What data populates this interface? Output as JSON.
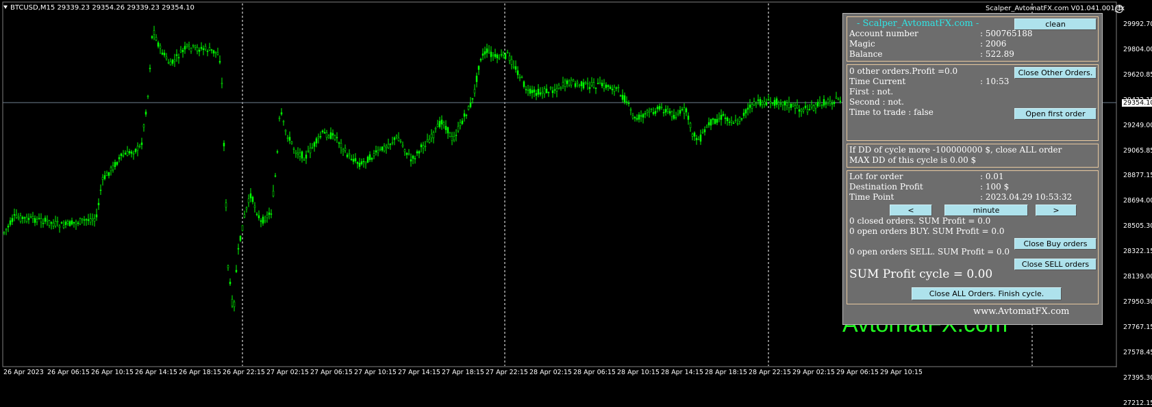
{
  "header": {
    "symbol_info": "BTCUSD,M15  29339.23 29354.26 29339.23 29354.10",
    "ea_name": "Scalper_AvtomatFX.com V01.041.001_fx",
    "smiley": "☺"
  },
  "watermark": "AvtomatFX.com",
  "price_axis": {
    "labels": [
      "29992.70",
      "29804.00",
      "29620.85",
      "29432.15",
      "29249.00",
      "29065.85",
      "28877.15",
      "28694.00",
      "28505.30",
      "28322.15",
      "28139.00",
      "27950.30",
      "27767.15",
      "27578.45",
      "27395.30",
      "27212.15"
    ],
    "current_price": "29354.10"
  },
  "time_axis": {
    "labels": [
      "26 Apr 2023",
      "26 Apr 06:15",
      "26 Apr 10:15",
      "26 Apr 14:15",
      "26 Apr 18:15",
      "26 Apr 22:15",
      "27 Apr 02:15",
      "27 Apr 06:15",
      "27 Apr 10:15",
      "27 Apr 14:15",
      "27 Apr 18:15",
      "27 Apr 22:15",
      "28 Apr 02:15",
      "28 Apr 06:15",
      "28 Apr 10:15",
      "28 Apr 14:15",
      "28 Apr 18:15",
      "28 Apr 22:15",
      "29 Apr 02:15",
      "29 Apr 06:15",
      "29 Apr 10:15"
    ]
  },
  "colors": {
    "candle": "#00ff00",
    "grid": "#ffffff",
    "bid_line": "#708090",
    "panel_bg": "#6d6d6d",
    "title": "#2ee6e6",
    "button_bg": "#aee2ec"
  },
  "panel": {
    "header": {
      "title": "- Scalper_AvtomatFX.com -",
      "clean_label": "clean",
      "account_label": "Account number",
      "account_value": ": 500765188",
      "magic_label": "Magic",
      "magic_value": ": 2006",
      "balance_label": "Balance",
      "balance_value": ": 522.89"
    },
    "status": {
      "other_orders": "0 other orders.Profit =0.0",
      "close_other_label": "Close Other Orders.",
      "time_current_label": "Time Current",
      "time_current_value": ": 10:53",
      "first": "First      : not.",
      "second": "Second  : not.",
      "time_to_trade": "Time to trade :  false",
      "open_first_label": "Open first order"
    },
    "dd": {
      "line1": "If DD of cycle more -100000000 $, close ALL order",
      "line2": "MAX DD of this cycle is 0.00 $"
    },
    "orders": {
      "lot_label": "Lot for order",
      "lot_value": ": 0.01",
      "dest_label": "Destination Profit",
      "dest_value": ": 100 $",
      "timepoint_label": "Time Point",
      "timepoint_value": ": 2023.04.29 10:53:32",
      "prev_label": "<",
      "unit_label": "minute",
      "next_label": ">",
      "closed_orders": "0 closed orders. SUM Profit = 0.0",
      "open_buy": "0 open orders BUY. SUM Profit = 0.0",
      "close_buy_label": "Close Buy orders",
      "open_sell": "0 open orders SELL. SUM Profit = 0.0",
      "close_sell_label": "Close SELL orders",
      "sum_profit": "SUM Profit cycle = 0.00",
      "close_all_label": "Close ALL Orders. Finish cycle."
    },
    "website": "www.AvtomatFX.com"
  }
}
